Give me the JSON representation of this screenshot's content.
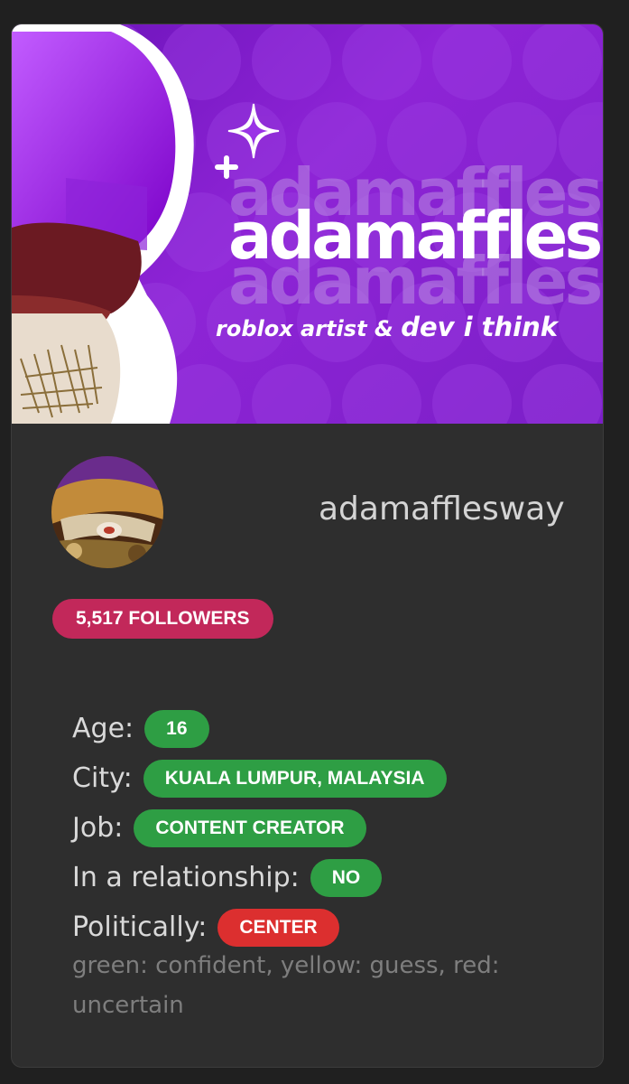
{
  "banner": {
    "title": "adamaffles",
    "tagline_prefix": "roblox artist & ",
    "tagline_dev": "dev",
    "tagline_suffix": " i think"
  },
  "profile": {
    "username": "adamafflesway",
    "followers_label": "5,517 FOLLOWERS"
  },
  "facts": [
    {
      "label": "Age:",
      "value": "16",
      "confidence": "green"
    },
    {
      "label": "City:",
      "value": "KUALA LUMPUR, MALAYSIA",
      "confidence": "green"
    },
    {
      "label": "Job:",
      "value": "CONTENT CREATOR",
      "confidence": "green"
    },
    {
      "label": "In a relationship:",
      "value": "NO",
      "confidence": "green"
    },
    {
      "label": "Politically:",
      "value": "CENTER",
      "confidence": "red"
    }
  ],
  "legend": "green: confident, yellow: guess, red: uncertain",
  "colors": {
    "card_background": "#2e2e2e",
    "page_background": "#202020",
    "followers_badge": "#c2285a",
    "confident_green": "#2e9e44",
    "uncertain_red": "#dc2f2f",
    "banner_purple": "#8e24d6"
  }
}
